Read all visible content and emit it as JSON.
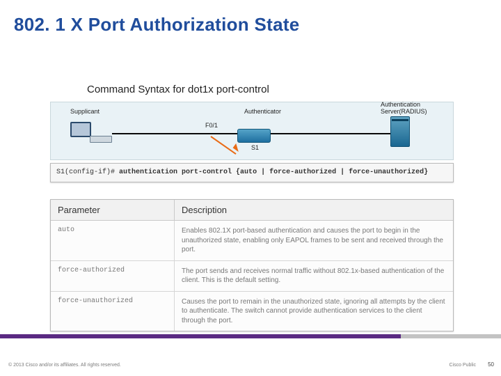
{
  "title": "802. 1 X Port Authorization State",
  "subhead": "Command Syntax for dot1x port-control",
  "topology": {
    "supplicant_label": "Supplicant",
    "interface_label": "F0/1",
    "switch_label": "S1",
    "authenticator_label": "Authenticator",
    "server_label_l1": "Authentication",
    "server_label_l2": "Server(RADIUS)"
  },
  "config": {
    "prompt": "S1(config-if)#",
    "cmd": "authentication port-control {auto | force-authorized | force-unauthorized}"
  },
  "table": {
    "h1": "Parameter",
    "h2": "Description",
    "rows": [
      {
        "param": "auto",
        "desc": "Enables 802.1X port-based authentication and causes the port to begin in the unauthorized state, enabling only EAPOL frames to be sent and received through the port."
      },
      {
        "param": "force-authorized",
        "desc": "The port sends and receives normal traffic without 802.1x-based authentication of the client. This is the default setting."
      },
      {
        "param": "force-unauthorized",
        "desc": "Causes the port to remain in the unauthorized state, ignoring all attempts by the client to authenticate. The switch cannot provide authentication services to the client through the port."
      }
    ]
  },
  "footer": {
    "copyright": "© 2013 Cisco and/or its affiliates. All rights reserved.",
    "public": "Cisco Public",
    "page": "50"
  }
}
